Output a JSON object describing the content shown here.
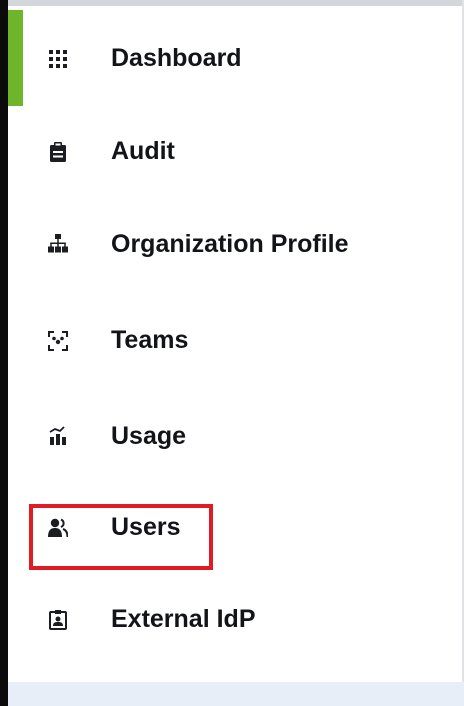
{
  "sidebar": {
    "items": [
      {
        "label": "Dashboard",
        "icon": "dashboard-grid-icon",
        "active": true
      },
      {
        "label": "Audit",
        "icon": "clipboard-icon"
      },
      {
        "label": "Organization Profile",
        "icon": "org-chart-icon"
      },
      {
        "label": "Teams",
        "icon": "teams-icon"
      },
      {
        "label": "Usage",
        "icon": "usage-bars-icon"
      },
      {
        "label": "Users",
        "icon": "users-icon",
        "highlighted": true
      },
      {
        "label": "External IdP",
        "icon": "id-badge-icon"
      }
    ]
  },
  "colors": {
    "active_indicator": "#6fb52c",
    "highlight_border": "#e01b24",
    "text": "#121418",
    "edge": "#0b0b0b"
  }
}
